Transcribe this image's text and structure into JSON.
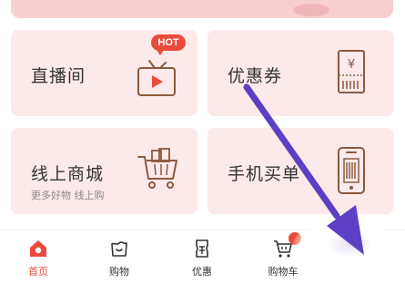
{
  "cards": [
    {
      "title": "直播间",
      "icon": "live-tv-icon",
      "badge": "HOT"
    },
    {
      "title": "优惠券",
      "icon": "coupon-ticket-icon"
    },
    {
      "title": "线上商城",
      "subtitle": "更多好物 线上购",
      "icon": "shopping-cart-icon"
    },
    {
      "title": "手机买单",
      "icon": "phone-barcode-icon"
    }
  ],
  "tabs": [
    {
      "label": "首页",
      "icon": "home-icon",
      "active": true
    },
    {
      "label": "购物",
      "icon": "shopping-bag-icon",
      "active": false
    },
    {
      "label": "优惠",
      "icon": "coupon-icon",
      "active": false
    },
    {
      "label": "购物车",
      "icon": "cart-icon",
      "active": false
    }
  ],
  "colors": {
    "accent": "#e84b3c",
    "card_bg": "#fce9e9",
    "icon_stroke": "#8b5a3c",
    "arrow": "#5b3fc4"
  }
}
